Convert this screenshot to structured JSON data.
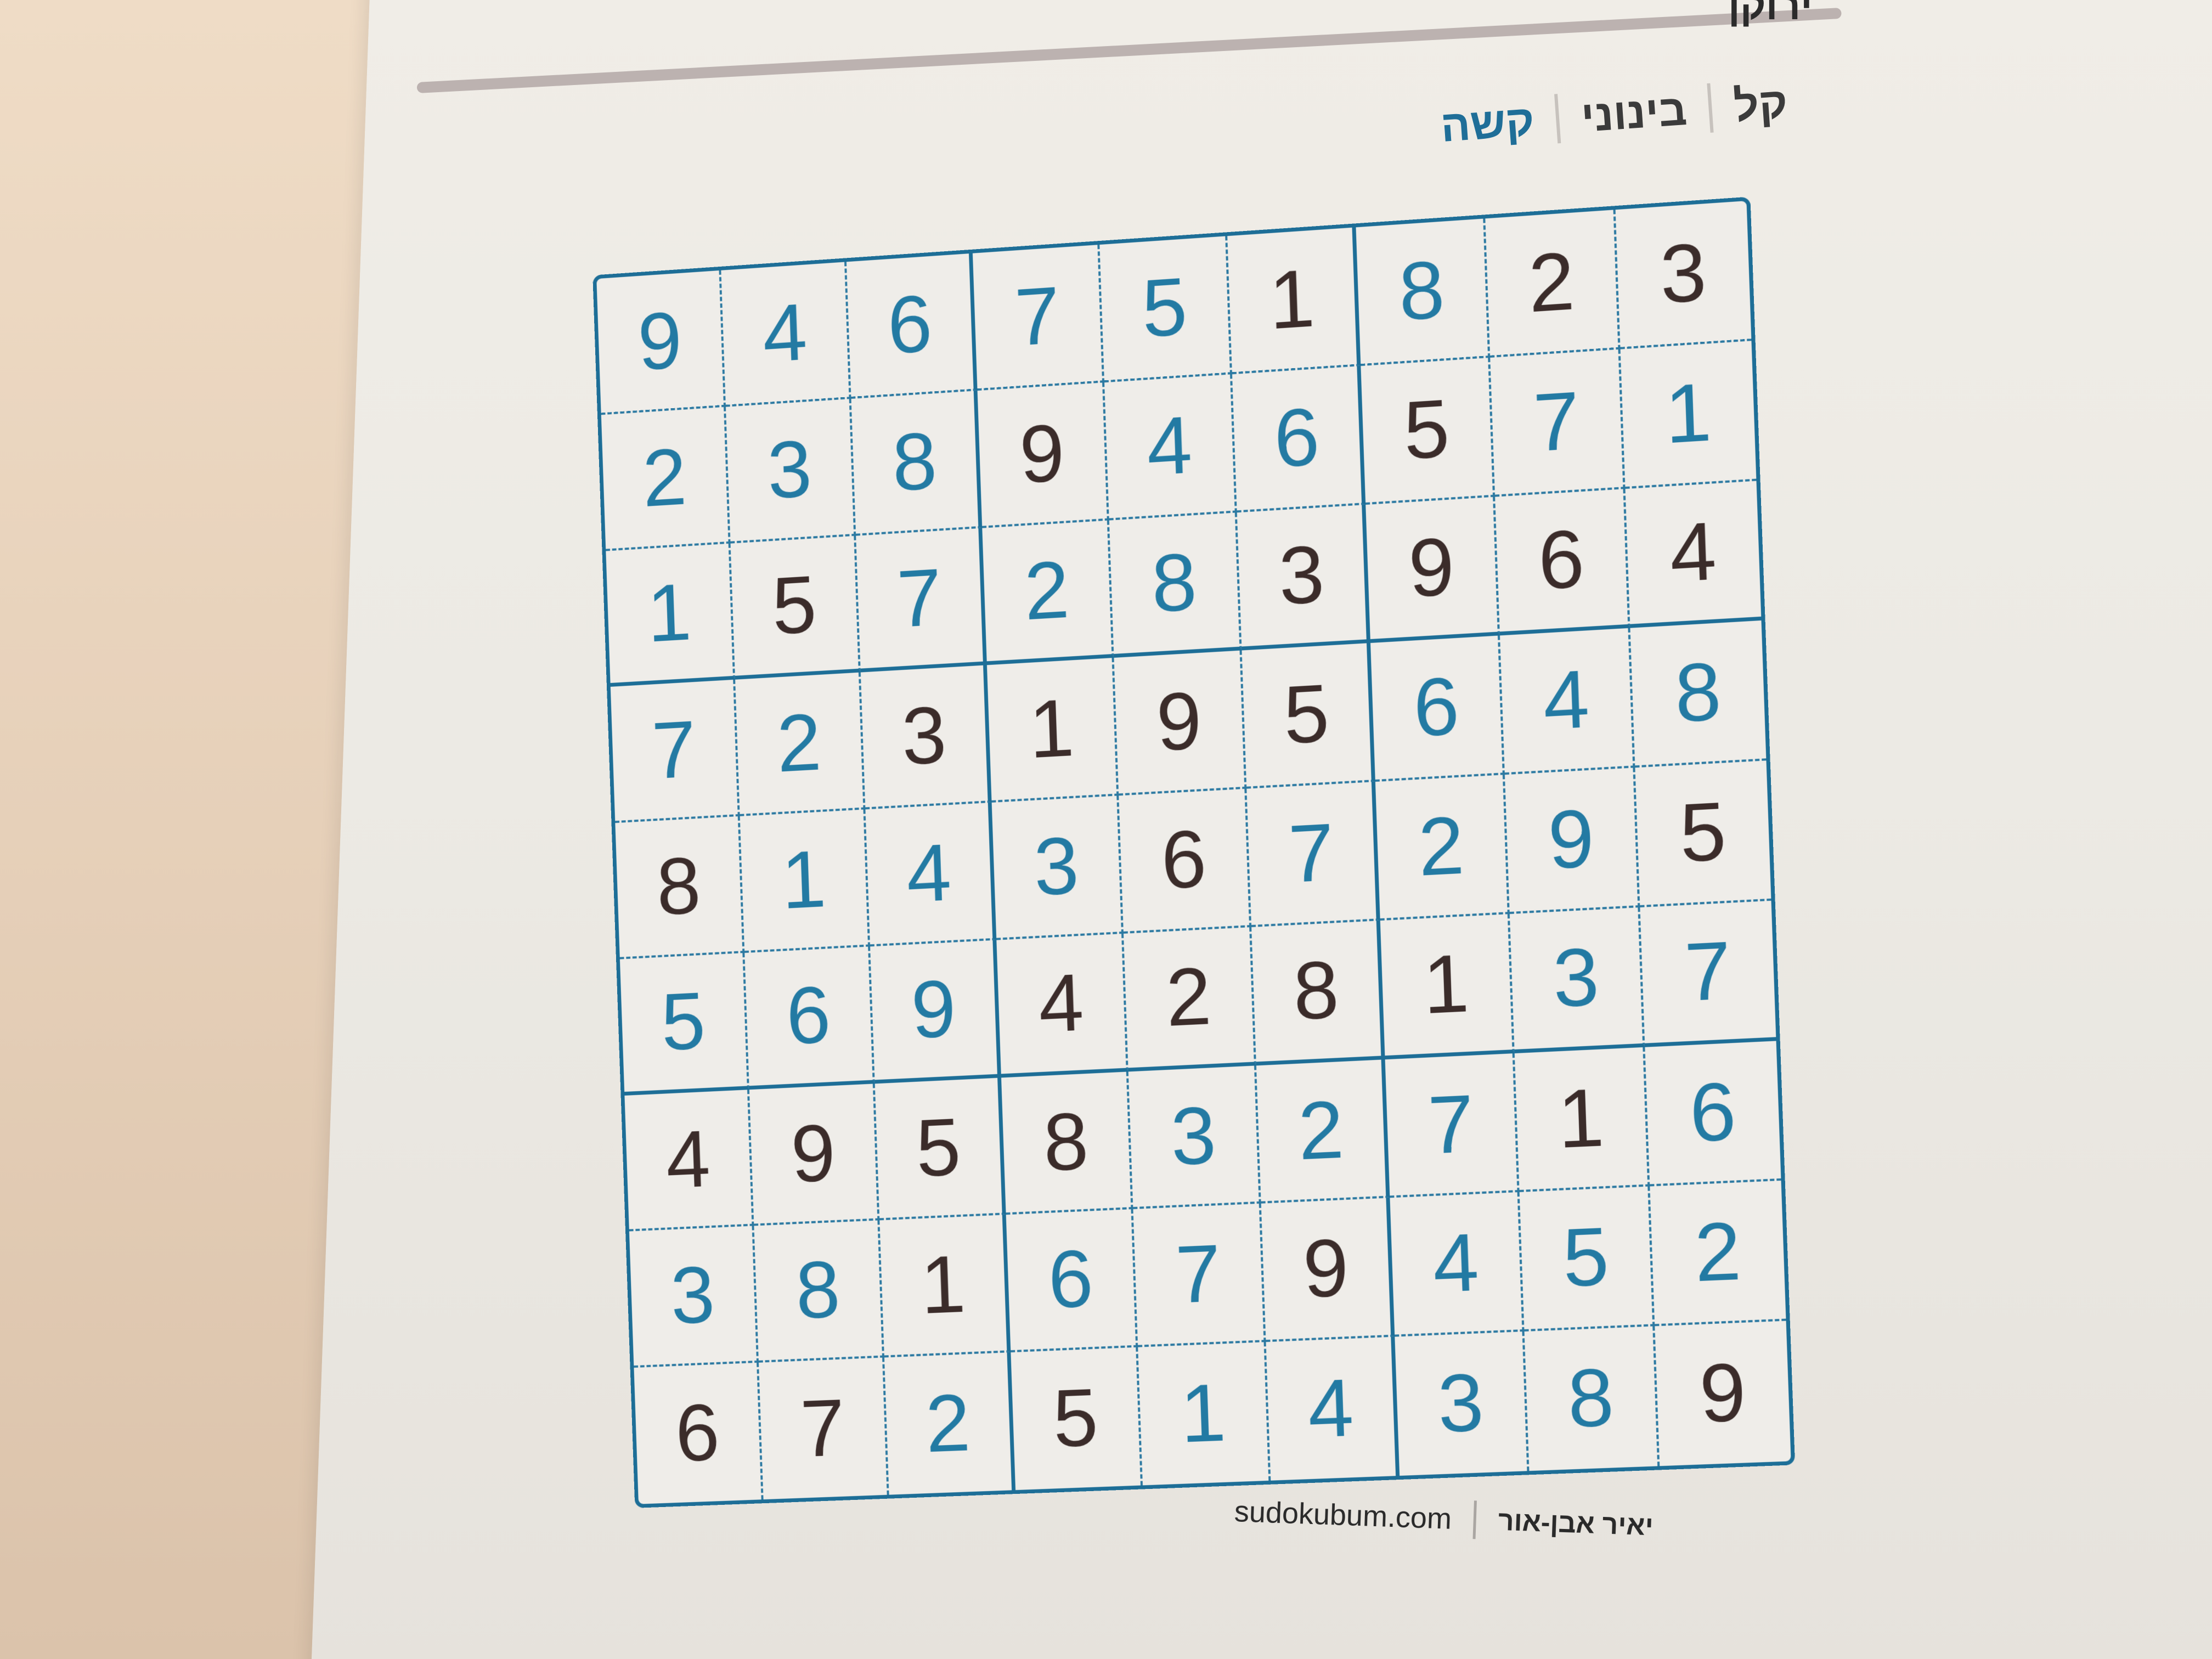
{
  "page": {
    "title_fragment": "ירוקן"
  },
  "tabs": [
    {
      "label": "קל",
      "active": false
    },
    {
      "label": "בינוני",
      "active": false
    },
    {
      "label": "קשה",
      "active": true
    }
  ],
  "colors": {
    "grid": "#1d6e97",
    "given_digit": "#3b2c2a",
    "solved_digit": "#237aa3",
    "active_tab": "#1f6e98"
  },
  "sudoku": {
    "rows": [
      [
        "9",
        "4",
        "6",
        "7",
        "5",
        "1",
        "8",
        "2",
        "3"
      ],
      [
        "2",
        "3",
        "8",
        "9",
        "4",
        "6",
        "5",
        "7",
        "1"
      ],
      [
        "1",
        "5",
        "7",
        "2",
        "8",
        "3",
        "9",
        "6",
        "4"
      ],
      [
        "7",
        "2",
        "3",
        "1",
        "9",
        "5",
        "6",
        "4",
        "8"
      ],
      [
        "8",
        "1",
        "4",
        "3",
        "6",
        "7",
        "2",
        "9",
        "5"
      ],
      [
        "5",
        "6",
        "9",
        "4",
        "2",
        "8",
        "1",
        "3",
        "7"
      ],
      [
        "4",
        "9",
        "5",
        "8",
        "3",
        "2",
        "7",
        "1",
        "6"
      ],
      [
        "3",
        "8",
        "1",
        "6",
        "7",
        "9",
        "4",
        "5",
        "2"
      ],
      [
        "6",
        "7",
        "2",
        "5",
        "1",
        "4",
        "3",
        "8",
        "9"
      ]
    ],
    "kind": [
      [
        "s",
        "s",
        "s",
        "s",
        "s",
        "g",
        "s",
        "g",
        "g"
      ],
      [
        "s",
        "s",
        "s",
        "g",
        "s",
        "s",
        "g",
        "s",
        "s"
      ],
      [
        "s",
        "g",
        "s",
        "s",
        "s",
        "g",
        "g",
        "g",
        "g"
      ],
      [
        "s",
        "s",
        "g",
        "g",
        "g",
        "g",
        "s",
        "s",
        "s"
      ],
      [
        "g",
        "s",
        "s",
        "s",
        "g",
        "s",
        "s",
        "s",
        "g"
      ],
      [
        "s",
        "s",
        "s",
        "g",
        "g",
        "g",
        "g",
        "s",
        "s"
      ],
      [
        "g",
        "g",
        "g",
        "g",
        "s",
        "s",
        "s",
        "g",
        "s"
      ],
      [
        "s",
        "s",
        "g",
        "s",
        "s",
        "g",
        "s",
        "s",
        "s"
      ],
      [
        "g",
        "g",
        "s",
        "g",
        "s",
        "s",
        "s",
        "s",
        "g"
      ]
    ]
  },
  "footer": {
    "site": "sudokubum.com",
    "author": "יאיר אבן-אור"
  }
}
